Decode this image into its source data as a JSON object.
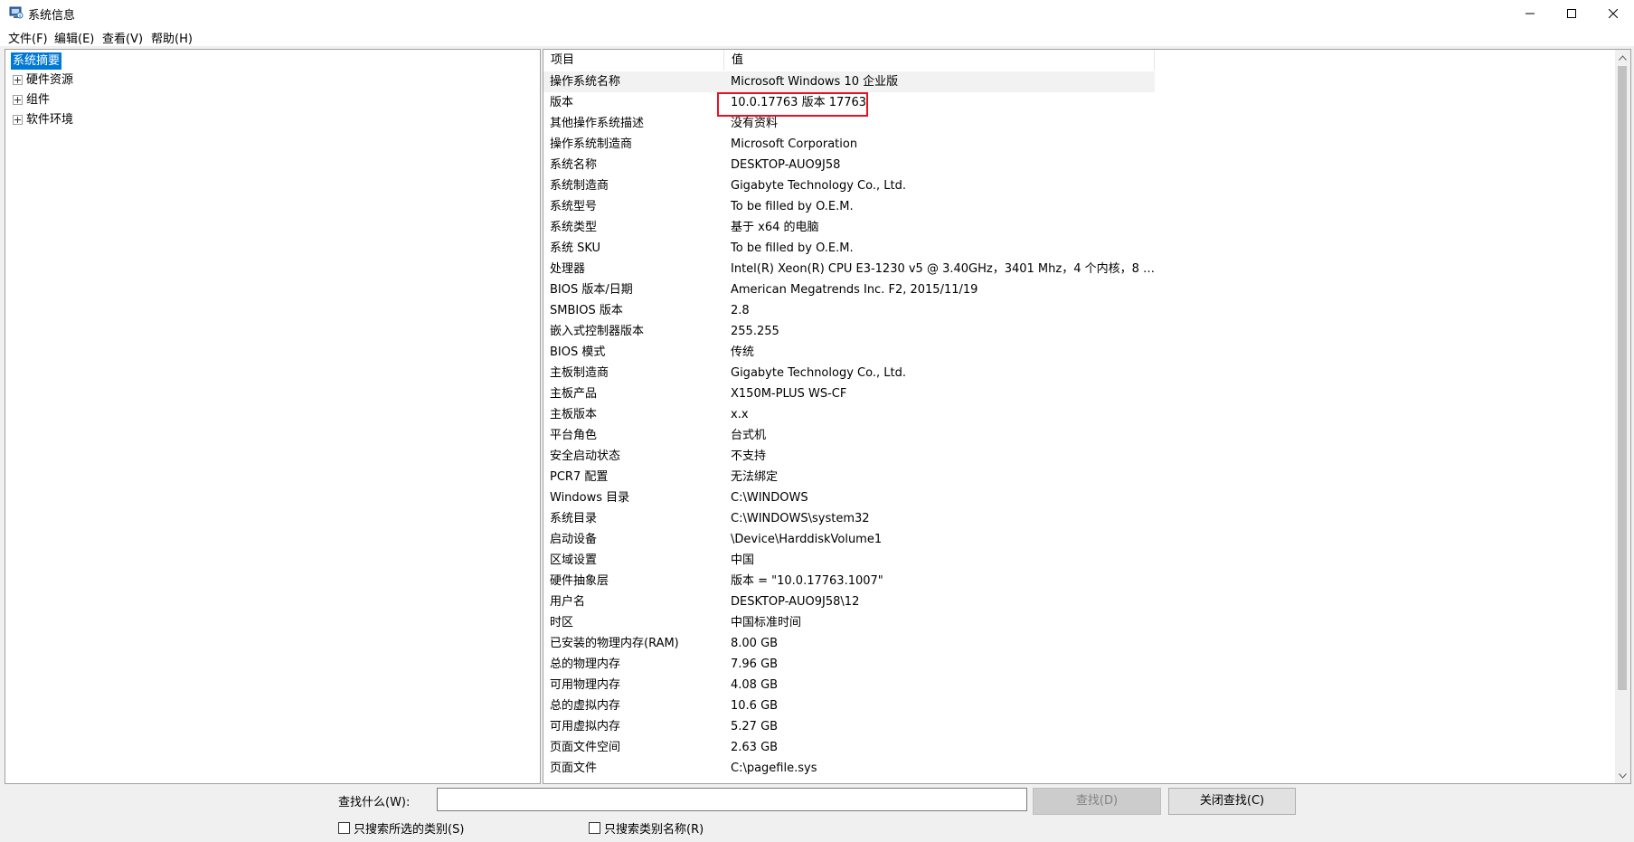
{
  "window": {
    "title": "系统信息",
    "icon": "system-information-icon",
    "controls": [
      "minimize-icon",
      "maximize-icon",
      "close-icon"
    ]
  },
  "menu": [
    "文件(F)",
    "编辑(E)",
    "查看(V)",
    "帮助(H)"
  ],
  "tree": {
    "root": "系统摘要",
    "children": [
      "硬件资源",
      "组件",
      "软件环境"
    ]
  },
  "list": {
    "headers": {
      "item": "项目",
      "value": "值"
    },
    "rows": [
      {
        "name": "操作系统名称",
        "value": "Microsoft Windows 10 企业版"
      },
      {
        "name": "版本",
        "value": "10.0.17763 版本 17763"
      },
      {
        "name": "其他操作系统描述",
        "value": "没有资料"
      },
      {
        "name": "操作系统制造商",
        "value": "Microsoft Corporation"
      },
      {
        "name": "系统名称",
        "value": "DESKTOP-AUO9J58"
      },
      {
        "name": "系统制造商",
        "value": "Gigabyte Technology Co., Ltd."
      },
      {
        "name": "系统型号",
        "value": "To be filled by O.E.M."
      },
      {
        "name": "系统类型",
        "value": "基于 x64 的电脑"
      },
      {
        "name": "系统 SKU",
        "value": "To be filled by O.E.M."
      },
      {
        "name": "处理器",
        "value": "Intel(R) Xeon(R) CPU E3-1230 v5 @ 3.40GHz，3401 Mhz，4 个内核，8 个..."
      },
      {
        "name": "BIOS 版本/日期",
        "value": "American Megatrends Inc. F2, 2015/11/19"
      },
      {
        "name": "SMBIOS 版本",
        "value": "2.8"
      },
      {
        "name": "嵌入式控制器版本",
        "value": "255.255"
      },
      {
        "name": "BIOS 模式",
        "value": "传统"
      },
      {
        "name": "主板制造商",
        "value": "Gigabyte Technology Co., Ltd."
      },
      {
        "name": "主板产品",
        "value": "X150M-PLUS WS-CF"
      },
      {
        "name": "主板版本",
        "value": "x.x"
      },
      {
        "name": "平台角色",
        "value": "台式机"
      },
      {
        "name": "安全启动状态",
        "value": "不支持"
      },
      {
        "name": "PCR7 配置",
        "value": "无法绑定"
      },
      {
        "name": "Windows 目录",
        "value": "C:\\WINDOWS"
      },
      {
        "name": "系统目录",
        "value": "C:\\WINDOWS\\system32"
      },
      {
        "name": "启动设备",
        "value": "\\Device\\HarddiskVolume1"
      },
      {
        "name": "区域设置",
        "value": "中国"
      },
      {
        "name": "硬件抽象层",
        "value": "版本 = \"10.0.17763.1007\""
      },
      {
        "name": "用户名",
        "value": "DESKTOP-AUO9J58\\12"
      },
      {
        "name": "时区",
        "value": "中国标准时间"
      },
      {
        "name": "已安装的物理内存(RAM)",
        "value": "8.00 GB"
      },
      {
        "name": "总的物理内存",
        "value": "7.96 GB"
      },
      {
        "name": "可用物理内存",
        "value": "4.08 GB"
      },
      {
        "name": "总的虚拟内存",
        "value": "10.6 GB"
      },
      {
        "name": "可用虚拟内存",
        "value": "5.27 GB"
      },
      {
        "name": "页面文件空间",
        "value": "2.63 GB"
      },
      {
        "name": "页面文件",
        "value": "C:\\pagefile.sys"
      }
    ],
    "selected_index": 0,
    "highlighted_index": 1,
    "highlight_color": "#e81123"
  },
  "find": {
    "label": "查找什么(W):",
    "value": "",
    "find_button": "查找(D)",
    "close_button": "关闭查找(C)",
    "checkbox1": "只搜索所选的类别(S)",
    "checkbox2": "只搜索类别名称(R)"
  },
  "colors": {
    "selection": "#0078d7",
    "highlight_box": "#e81123"
  }
}
